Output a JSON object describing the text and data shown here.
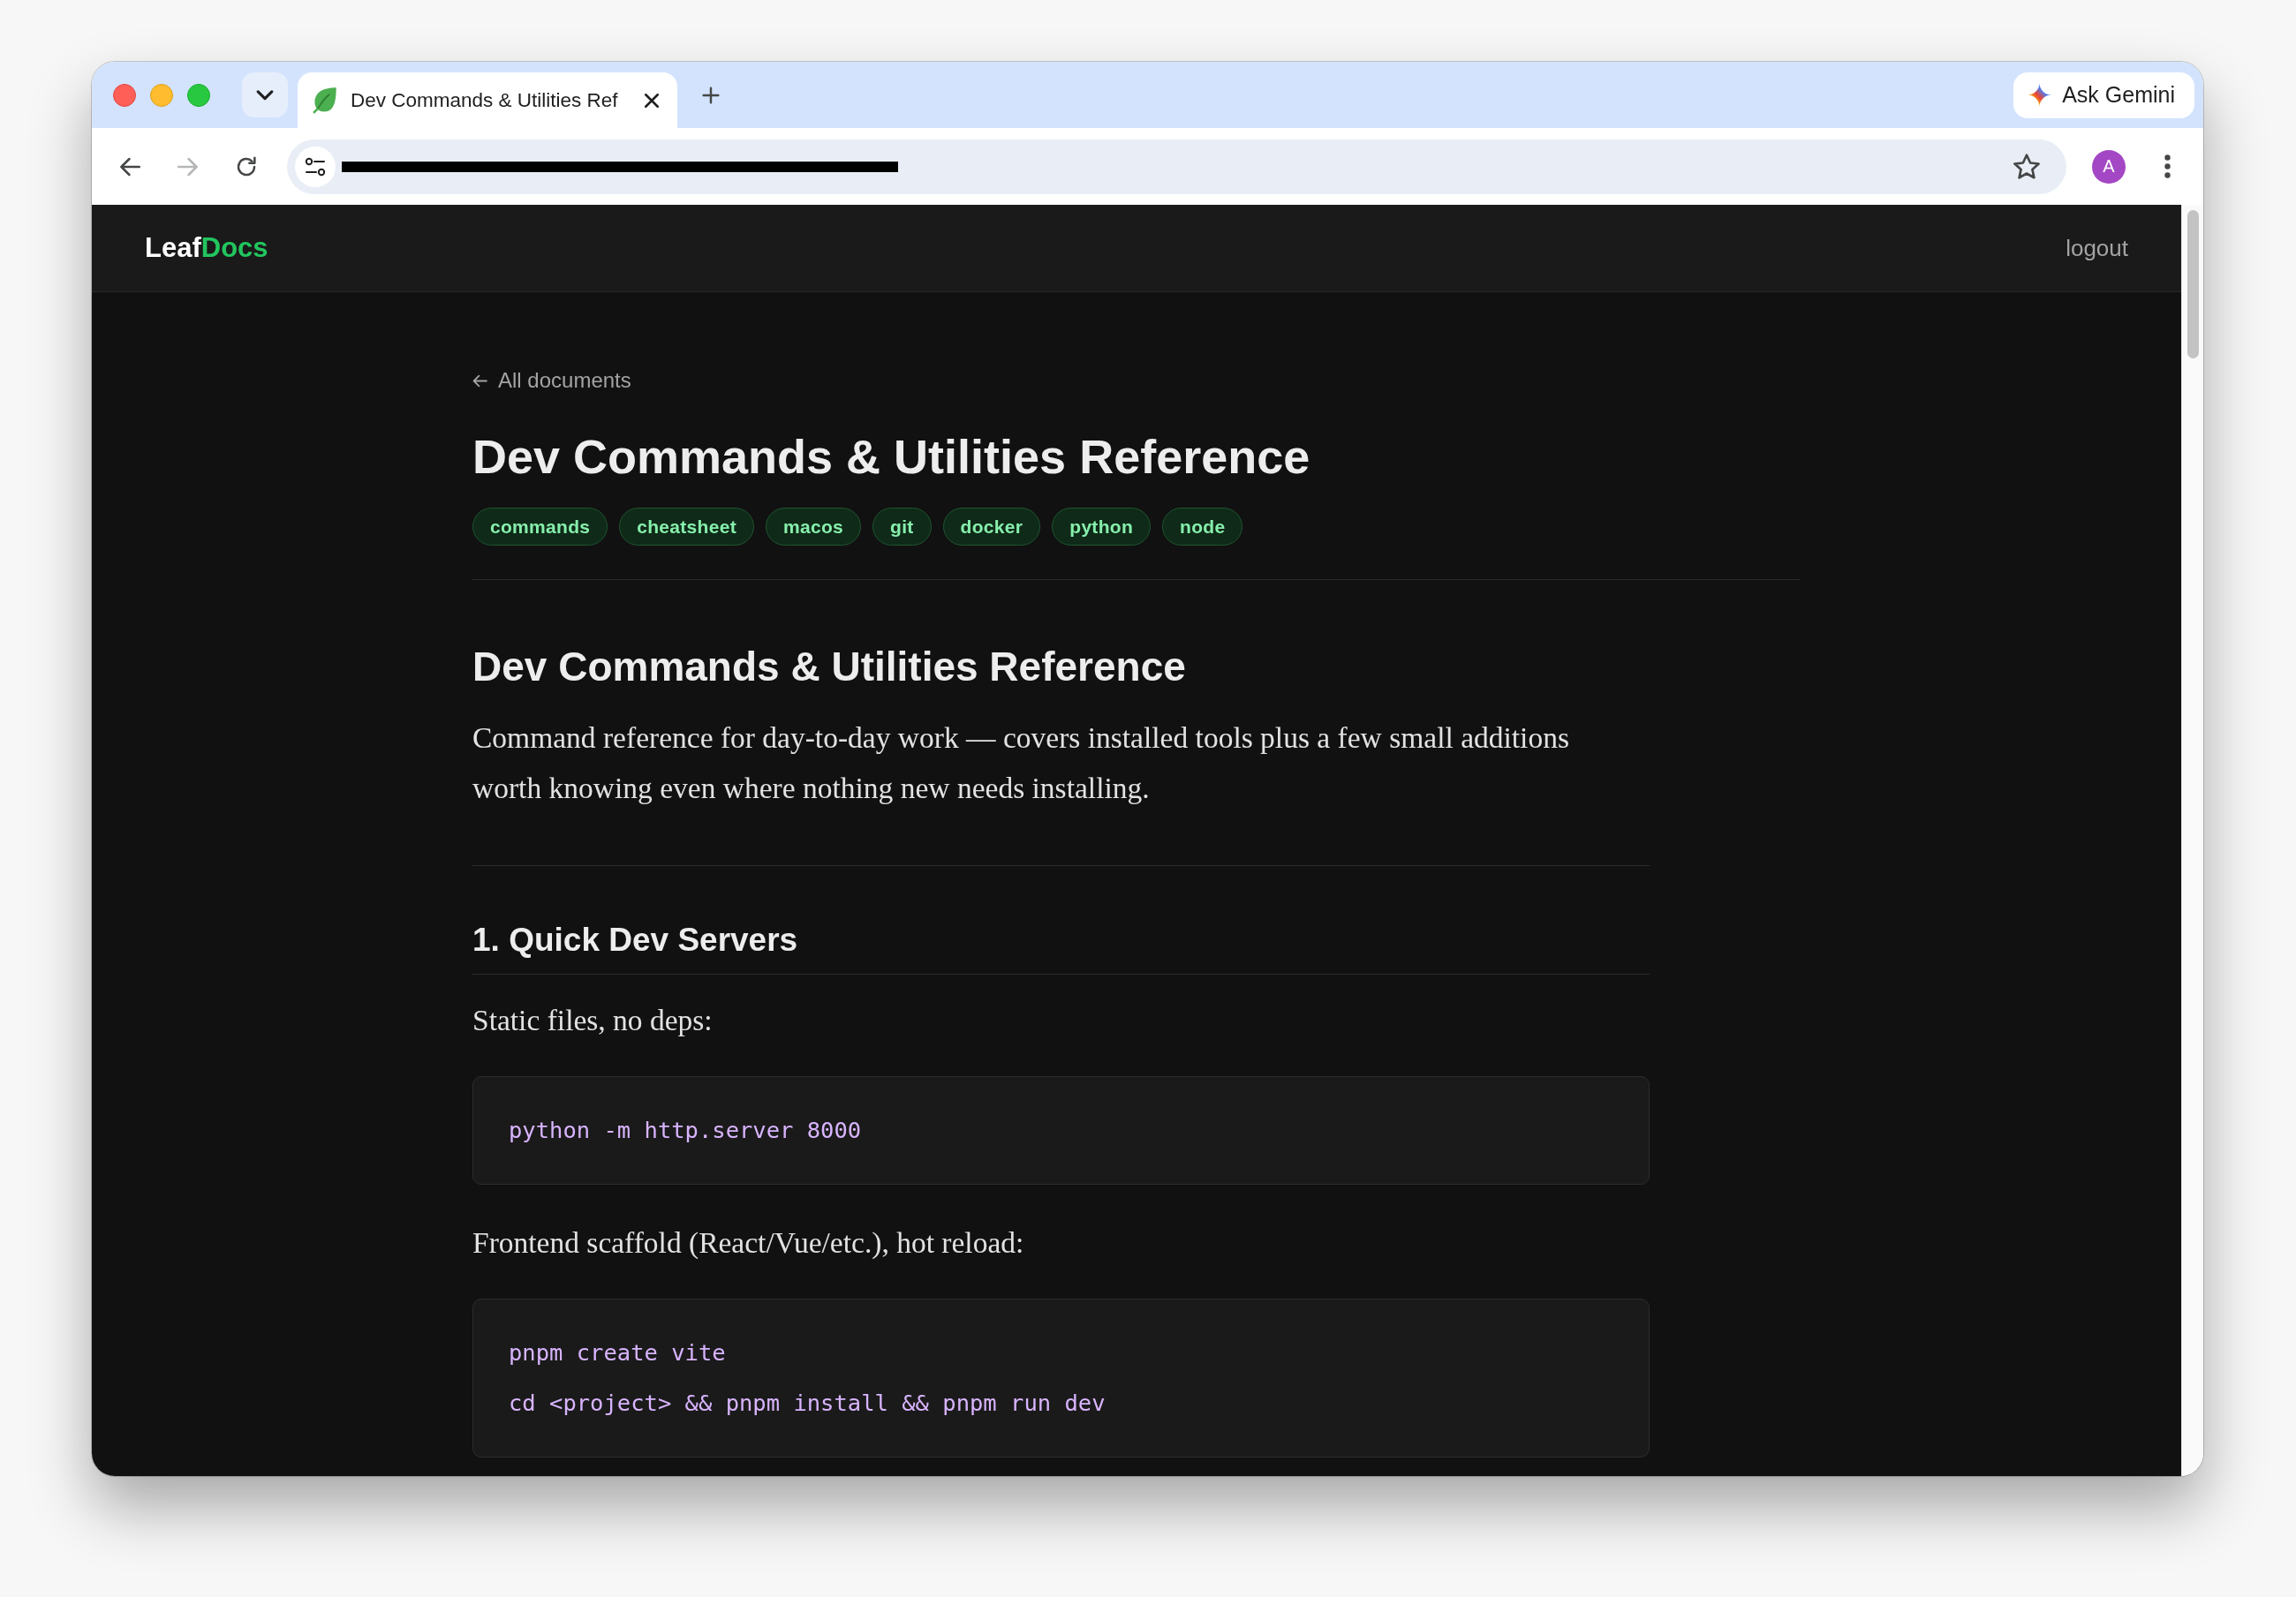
{
  "browser": {
    "tabs": [
      {
        "title": "Dev Commands & Utilities Ref",
        "selected": true
      }
    ],
    "gemini_button": {
      "label": "Ask Gemini"
    },
    "nav_buttons": [
      {
        "kind": "back",
        "disabled": false
      },
      {
        "kind": "forward",
        "disabled": true
      },
      {
        "kind": "reload",
        "disabled": false
      }
    ],
    "address_bar": {
      "redacted": true
    },
    "profile": {
      "initial": "A"
    }
  },
  "site_header": {
    "logo": {
      "text": "Leaf",
      "accent": "Docs"
    },
    "logout": "logout"
  },
  "document": {
    "back_link": "All documents",
    "title": "Dev Commands & Utilities Reference",
    "tags": [
      "commands",
      "cheatsheet",
      "macos",
      "git",
      "docker",
      "python",
      "node"
    ],
    "body": [
      {
        "kind": "heading1",
        "text": "Dev Commands & Utilities Reference"
      },
      {
        "kind": "paragraph",
        "text": "Command reference for day-to-day work — covers installed tools plus a few small additions worth knowing even where nothing new needs installing."
      },
      {
        "kind": "rule"
      },
      {
        "kind": "heading2",
        "text": "1. Quick Dev Servers"
      },
      {
        "kind": "paragraph",
        "text": "Static files, no deps:"
      },
      {
        "kind": "code",
        "lines": [
          "python -m http.server 8000"
        ]
      },
      {
        "kind": "paragraph",
        "text": "Frontend scaffold (React/Vue/etc.), hot reload:"
      },
      {
        "kind": "code",
        "lines": [
          "pnpm create vite",
          "cd <project> && pnpm install && pnpm run dev"
        ]
      }
    ]
  }
}
